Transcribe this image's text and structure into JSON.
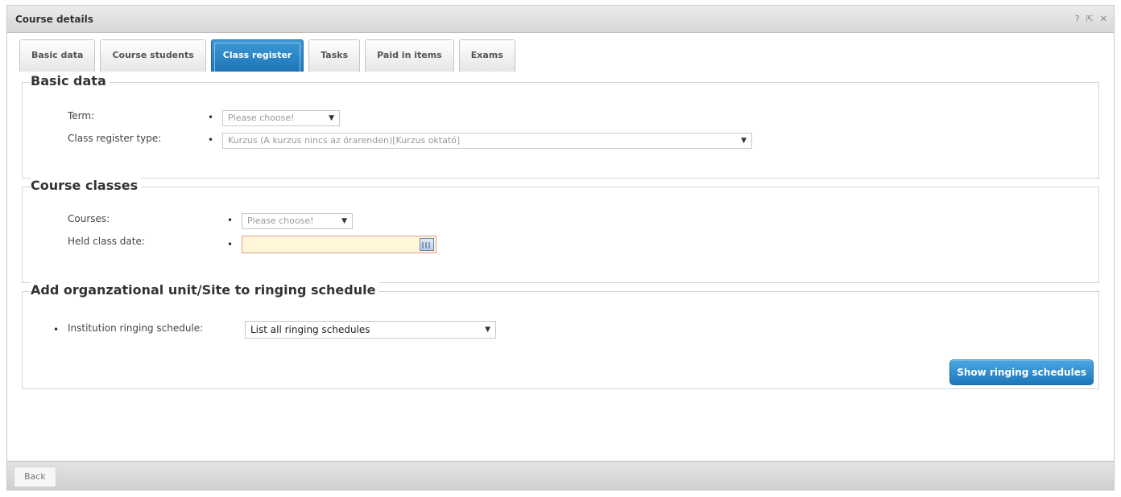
{
  "window": {
    "title": "Course details",
    "icons": {
      "help": "?",
      "popout": "⇱",
      "close": "✕"
    }
  },
  "tabs": [
    {
      "label": "Basic data"
    },
    {
      "label": "Course students"
    },
    {
      "label": "Class register",
      "active": true
    },
    {
      "label": "Tasks"
    },
    {
      "label": "Paid in items"
    },
    {
      "label": "Exams"
    }
  ],
  "basic_data": {
    "legend": "Basic data",
    "term_label": "Term:",
    "term_value": "Please choose!",
    "class_register_type_label": "Class register type:",
    "class_register_type_value": "Kurzus (A kurzus nincs az órarenden)[Kurzus oktató]"
  },
  "course_classes": {
    "legend": "Course classes",
    "courses_label": "Courses:",
    "courses_value": "Please choose!",
    "held_class_date_label": "Held class date:",
    "held_class_date_value": ""
  },
  "ringing": {
    "legend": "Add organzational unit/Site to ringing schedule",
    "schedule_label": "Institution ringing schedule:",
    "schedule_value": "List all ringing schedules",
    "show_button": "Show ringing schedules"
  },
  "footer": {
    "back_label": "Back"
  },
  "bullet_char": "•",
  "arrow_char": "▼",
  "colors": {
    "active_tab": "#1f74b6",
    "primary_button": "#1d76b9",
    "required_field_bg": "#fff6d8",
    "required_field_border": "#e39b9b"
  }
}
